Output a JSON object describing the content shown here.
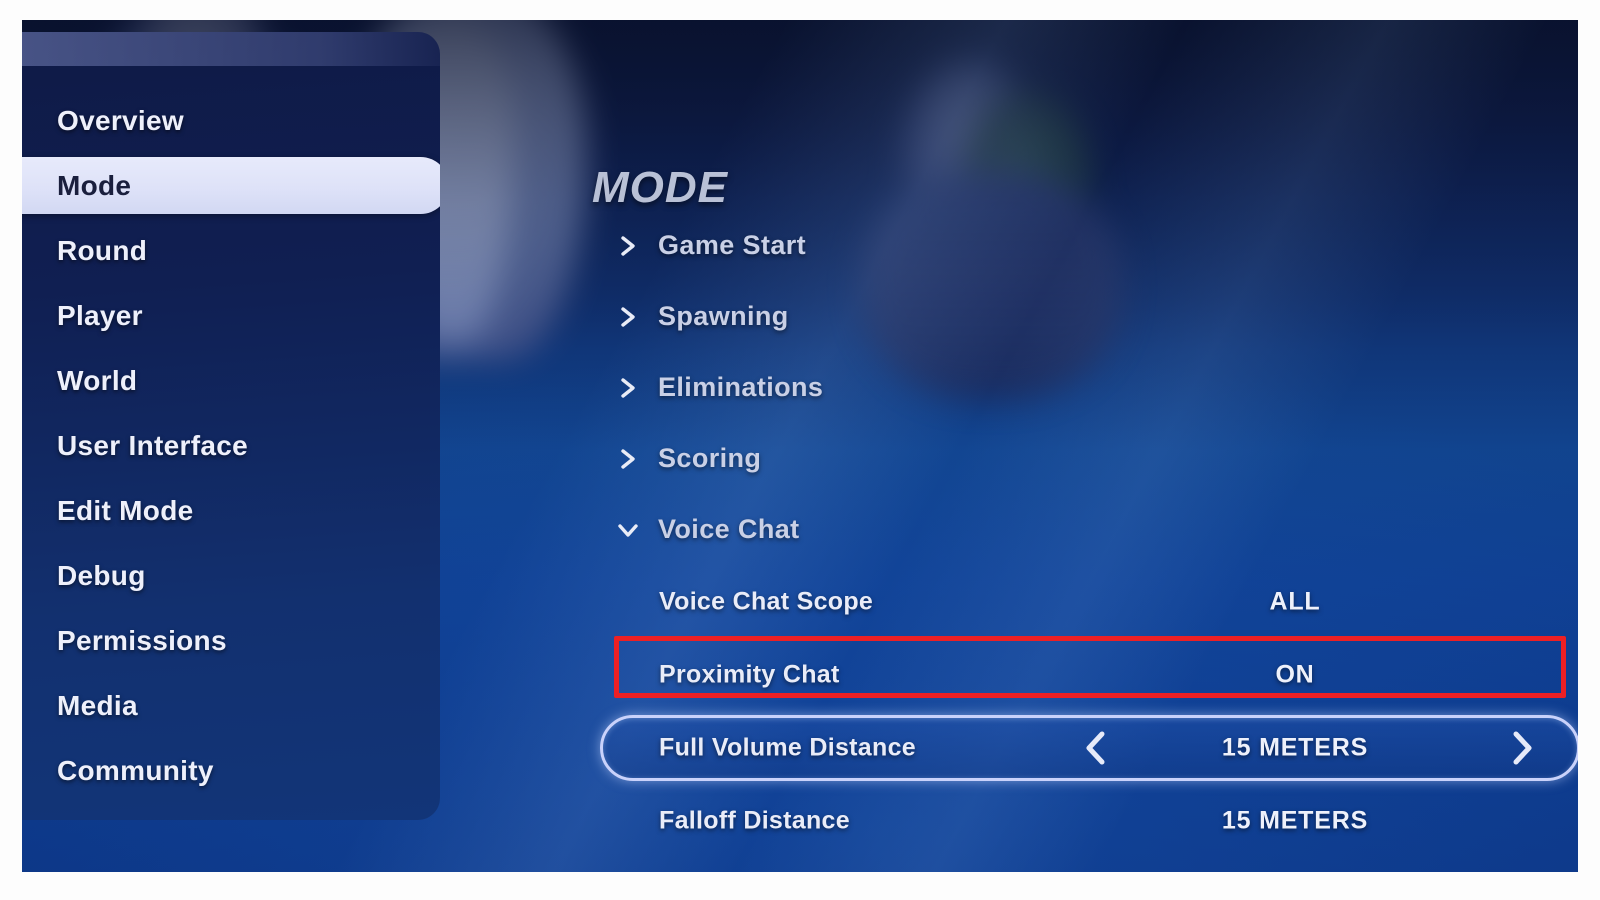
{
  "page": {
    "title": "MODE",
    "accent_red": "#ed2024",
    "selected_nav_bg": "#dee2f8",
    "panel_blue": "#11448f"
  },
  "sidebar": {
    "items": [
      {
        "label": "Overview",
        "selected": false
      },
      {
        "label": "Mode",
        "selected": true
      },
      {
        "label": "Round",
        "selected": false
      },
      {
        "label": "Player",
        "selected": false
      },
      {
        "label": "World",
        "selected": false
      },
      {
        "label": "User Interface",
        "selected": false
      },
      {
        "label": "Edit Mode",
        "selected": false
      },
      {
        "label": "Debug",
        "selected": false
      },
      {
        "label": "Permissions",
        "selected": false
      },
      {
        "label": "Media",
        "selected": false
      },
      {
        "label": "Community",
        "selected": false
      }
    ]
  },
  "sections": [
    {
      "label": "Game Start",
      "expanded": false
    },
    {
      "label": "Spawning",
      "expanded": false
    },
    {
      "label": "Eliminations",
      "expanded": false
    },
    {
      "label": "Scoring",
      "expanded": false
    },
    {
      "label": "Voice Chat",
      "expanded": true
    }
  ],
  "voice_chat_settings": [
    {
      "label": "Voice Chat Scope",
      "value": "ALL",
      "selected": false,
      "annotated": false,
      "stepper": false
    },
    {
      "label": "Proximity Chat",
      "value": "ON",
      "selected": false,
      "annotated": true,
      "stepper": false
    },
    {
      "label": "Full Volume Distance",
      "value": "15 METERS",
      "selected": true,
      "annotated": false,
      "stepper": true
    },
    {
      "label": "Falloff Distance",
      "value": "15 METERS",
      "selected": false,
      "annotated": false,
      "stepper": false
    }
  ],
  "icons": {
    "chevron_right": "chevron-right-icon",
    "chevron_down": "chevron-down-icon",
    "stepper_prev": "chevron-left-icon",
    "stepper_next": "chevron-right-icon"
  }
}
